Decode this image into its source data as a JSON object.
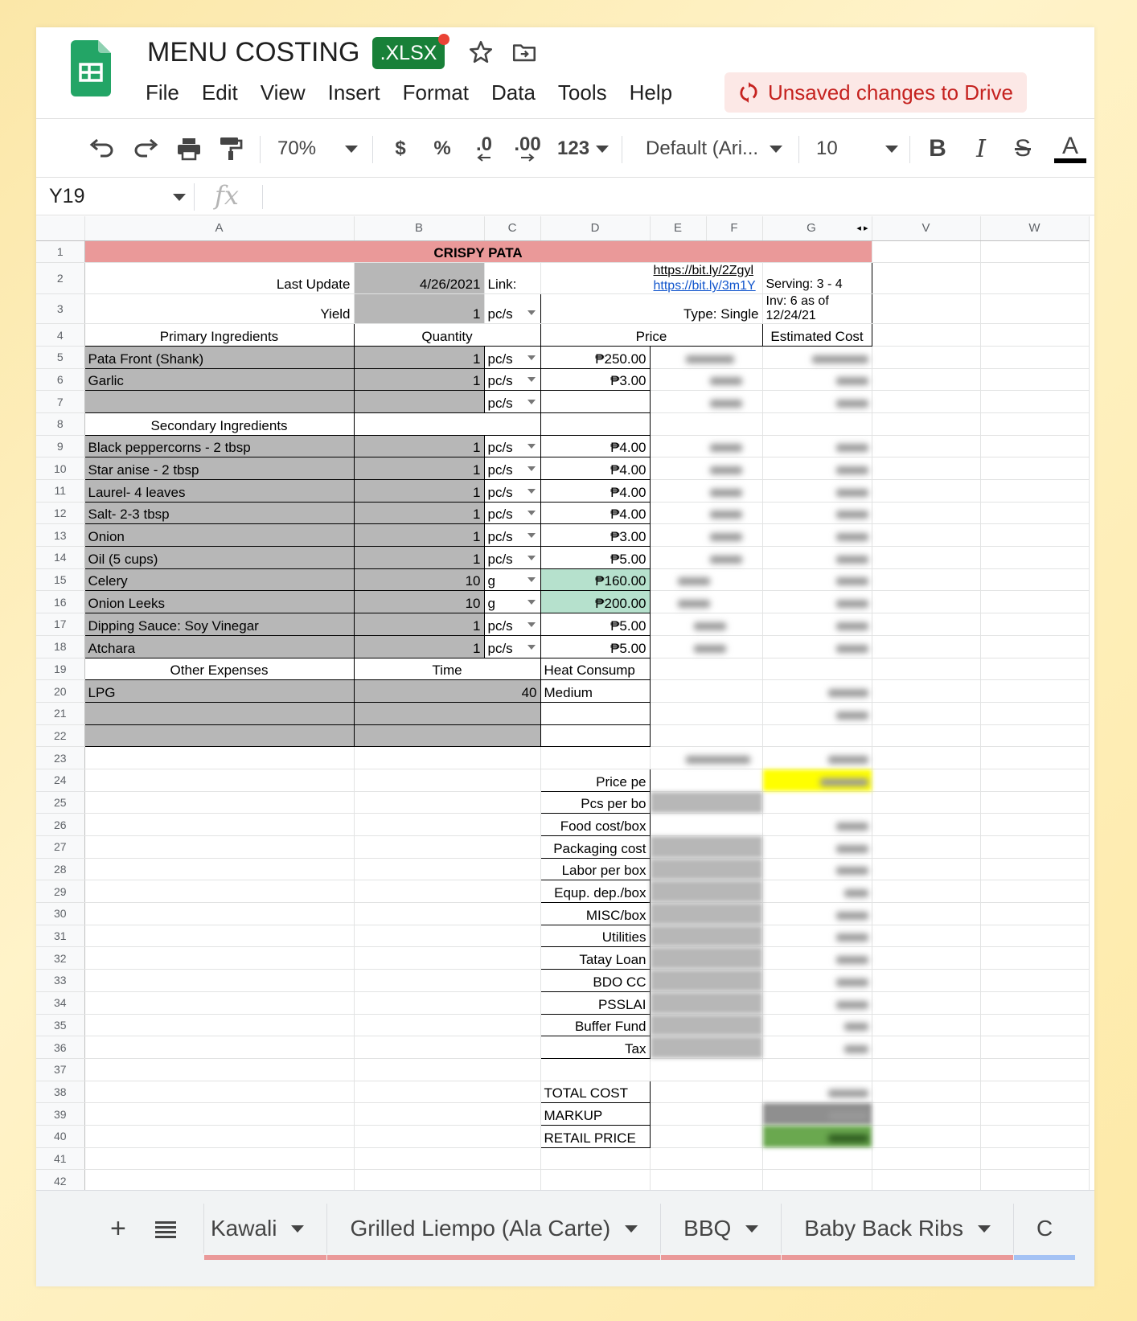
{
  "app": {
    "title": "MENU COSTING",
    "file_badge": ".XLSX",
    "unsaved_label": "Unsaved changes to Drive",
    "menu": [
      "File",
      "Edit",
      "View",
      "Insert",
      "Format",
      "Data",
      "Tools",
      "Help"
    ]
  },
  "toolbar": {
    "zoom": "70%",
    "currency": "$",
    "percent": "%",
    "dec_decrease": ".0",
    "dec_increase": ".00",
    "number_format": "123",
    "font": "Default (Ari...",
    "font_size": "10",
    "bold": "B",
    "italic": "I",
    "strike": "S",
    "text_color": "A"
  },
  "formula_bar": {
    "cell_ref": "Y19",
    "fx": "fx",
    "value": ""
  },
  "columns": [
    "A",
    "B",
    "C",
    "D",
    "E",
    "F",
    "G",
    "V",
    "W"
  ],
  "rows": [
    "1",
    "2",
    "3",
    "4",
    "5",
    "6",
    "7",
    "8",
    "9",
    "10",
    "11",
    "12",
    "13",
    "14",
    "15",
    "16",
    "17",
    "18",
    "19",
    "20",
    "21",
    "22",
    "23",
    "24",
    "25",
    "26",
    "27",
    "28",
    "29",
    "30",
    "31",
    "32",
    "33",
    "34",
    "35",
    "36",
    "37",
    "38",
    "39",
    "40",
    "41",
    "42"
  ],
  "sheet": {
    "title": "CRISPY PATA",
    "last_update_label": "Last Update",
    "last_update": "4/26/2021",
    "link_label": "Link:",
    "link1": "https://bit.ly/2Zgyl",
    "link2": "https://bit.ly/3m1Y",
    "serving": "Serving: 3 - 4",
    "yield_label": "Yield",
    "yield_value": "1",
    "yield_unit": "pc/s",
    "type_label": "Type:  Single",
    "inv_note": "Inv: 6 as of 12/24/21",
    "primary_header": "Primary Ingredients",
    "quantity_header": "Quantity",
    "price_header": "Price",
    "estimated_cost_header": "Estimated Cost",
    "primary": [
      {
        "name": "Pata Front (Shank)",
        "qty": "1",
        "unit": "pc/s",
        "price": "₱250.00"
      },
      {
        "name": "Garlic",
        "qty": "1",
        "unit": "pc/s",
        "price": "₱3.00"
      },
      {
        "name": "",
        "qty": "",
        "unit": "pc/s",
        "price": ""
      }
    ],
    "secondary_header": "Secondary Ingredients",
    "secondary": [
      {
        "name": "Black peppercorns - 2 tbsp",
        "qty": "1",
        "unit": "pc/s",
        "price": "₱4.00"
      },
      {
        "name": "Star anise - 2 tbsp",
        "qty": "1",
        "unit": "pc/s",
        "price": "₱4.00"
      },
      {
        "name": "Laurel- 4 leaves",
        "qty": "1",
        "unit": "pc/s",
        "price": "₱4.00"
      },
      {
        "name": "Salt-  2-3 tbsp",
        "qty": "1",
        "unit": "pc/s",
        "price": "₱4.00"
      },
      {
        "name": "Onion",
        "qty": "1",
        "unit": "pc/s",
        "price": "₱3.00"
      },
      {
        "name": "Oil (5 cups)",
        "qty": "1",
        "unit": "pc/s",
        "price": "₱5.00"
      },
      {
        "name": "Celery",
        "qty": "10",
        "unit": "g",
        "price": "₱160.00"
      },
      {
        "name": "Onion Leeks",
        "qty": "10",
        "unit": "g",
        "price": "₱200.00"
      },
      {
        "name": "Dipping Sauce: Soy Vinegar",
        "qty": "1",
        "unit": "pc/s",
        "price": "₱5.00"
      },
      {
        "name": "Atchara",
        "qty": "1",
        "unit": "pc/s",
        "price": "₱5.00"
      }
    ],
    "other_header": "Other Expenses",
    "time_header": "Time",
    "heat_header": "Heat Consump",
    "lpg_label": "LPG",
    "lpg_time": "40",
    "lpg_heat": "Medium",
    "costs": [
      "Price pe",
      "Pcs per bo",
      "Food cost/box",
      "Packaging cost",
      "Labor per box",
      "Equp. dep./box",
      "MISC/box",
      "Utilities",
      "Tatay Loan",
      "BDO CC",
      "PSSLAI",
      "Buffer Fund",
      "Tax"
    ],
    "total_cost": "TOTAL COST",
    "markup": "MARKUP",
    "retail_price": "RETAIL PRICE"
  },
  "tabs": [
    "Kawali",
    "Grilled Liempo (Ala Carte)",
    "BBQ",
    "Baby Back Ribs"
  ],
  "colors": {
    "header_pink": "#ea9999",
    "input_grey": "#b7b7b7",
    "mint": "#b6e1cd",
    "highlight": "#ffff00",
    "retail_green": "#6aa84f",
    "unsaved_red": "#c5221f"
  }
}
